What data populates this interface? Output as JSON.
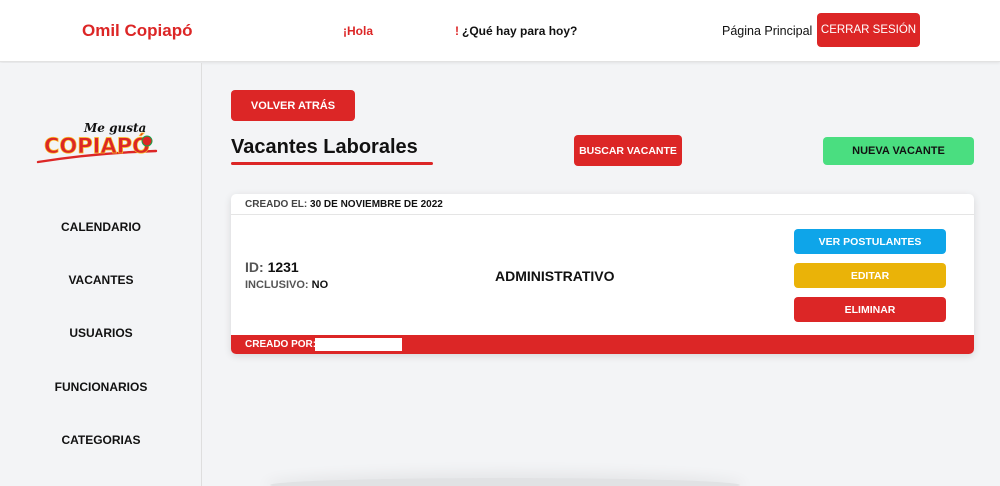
{
  "header": {
    "brand": "Omil Copiapó",
    "greeting": "¡Hola",
    "today_bang": "!",
    "today_text": "¿Qué hay para hoy?",
    "home_link": "Página Principal",
    "logout_label": "CERRAR SESIÓN"
  },
  "sidebar": {
    "logo": {
      "script": "Me gusta",
      "word": "COPIAPÓ"
    },
    "items": [
      "CALENDARIO",
      "VACANTES",
      "USUARIOS",
      "FUNCIONARIOS",
      "CATEGORIAS"
    ]
  },
  "main": {
    "back_label": "VOLVER ATRÁS",
    "title": "Vacantes Laborales",
    "search_label": "BUSCAR VACANTE",
    "new_label": "NUEVA VACANTE"
  },
  "vacancy": {
    "created_label": "CREADO EL:",
    "created_value": "30 DE NOVIEMBRE DE 2022",
    "id_label": "ID:",
    "id_value": "1231",
    "inclusive_label": "INCLUSIVO:",
    "inclusive_value": "NO",
    "title": "ADMINISTRATIVO",
    "applicants_label": "VER POSTULANTES",
    "edit_label": "EDITAR",
    "delete_label": "ELIMINAR",
    "created_by_label": "CREADO POR:"
  },
  "colors": {
    "brand_red": "#dc2626",
    "green": "#4ade80",
    "blue": "#0ea5e9",
    "yellow": "#eab308"
  }
}
